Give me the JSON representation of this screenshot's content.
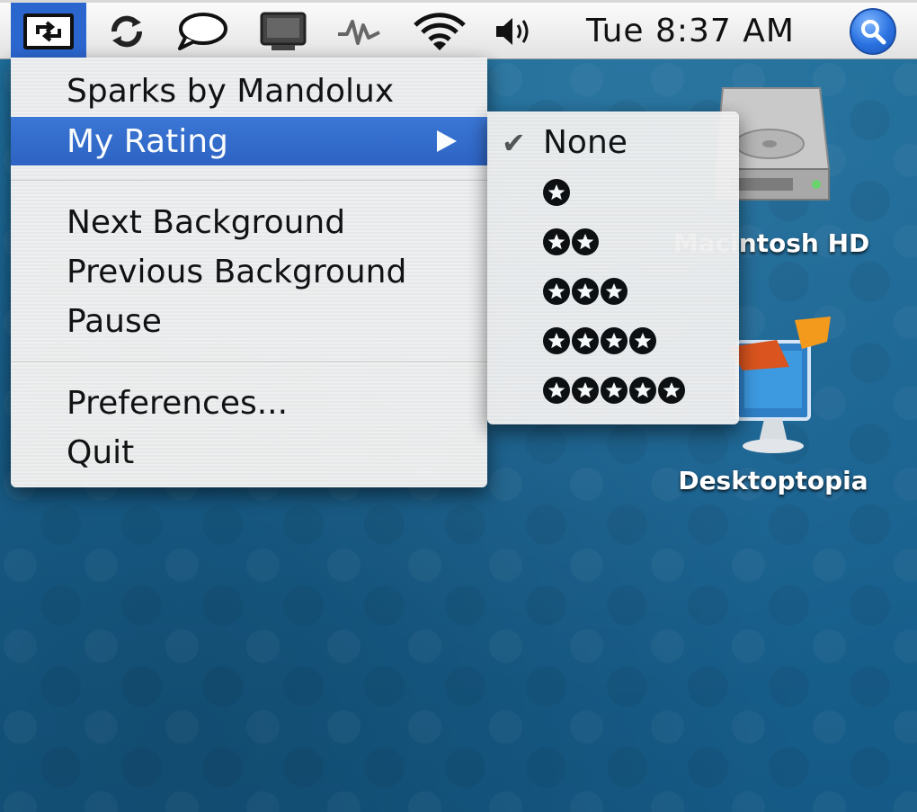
{
  "menubar": {
    "sparks_icon": "sparks-refresh-icon",
    "sync_icon": "sync-icon",
    "chat_icon": "chat-bubble-icon",
    "display_icon": "display-icon",
    "spark_icon": "spark-zigzag-icon",
    "wifi_icon": "wifi-icon",
    "volume_icon": "volume-icon",
    "clock": "Tue 8:37 AM",
    "spotlight_icon": "spotlight-search-icon",
    "spotlight_color": "#2a72e0",
    "highlight_color": "#2b66cf"
  },
  "menu": {
    "items": [
      {
        "label": "Sparks by Mandolux"
      },
      {
        "label": "My Rating",
        "selected": true,
        "has_submenu": true
      },
      {
        "label": "Next Background"
      },
      {
        "label": "Previous Background"
      },
      {
        "label": "Pause"
      },
      {
        "label": "Preferences..."
      },
      {
        "label": "Quit"
      }
    ],
    "selected_color": "#3c78d8"
  },
  "submenu": {
    "items": [
      {
        "label": "None",
        "checked": true
      },
      {
        "stars": 1
      },
      {
        "stars": 2
      },
      {
        "stars": 3
      },
      {
        "stars": 4
      },
      {
        "stars": 5
      }
    ]
  },
  "desktop": {
    "icons": [
      {
        "label": "Macintosh HD",
        "icon": "hard-drive-icon"
      },
      {
        "label": "Desktoptopia",
        "icon": "desktoptopia-icon"
      }
    ],
    "background_color": "#1a6594"
  }
}
